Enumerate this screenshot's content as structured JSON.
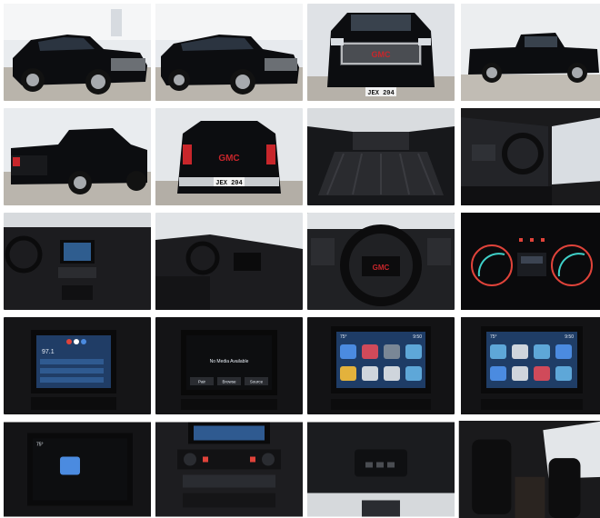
{
  "gallery": {
    "plates": {
      "front": "JEX 204",
      "rear": "JEX 204"
    },
    "brand": {
      "badge": "GMC",
      "color": "#c8262b"
    },
    "screens": {
      "radio_freq": "97.1",
      "no_media": "No Media Available",
      "buttons": [
        "Pair",
        "Browse",
        "Source"
      ],
      "temp": "75°",
      "clock": "9:50"
    },
    "colors": {
      "truck": "#0c0d10",
      "showroom_floor": "#b9b4ab",
      "interior": "#1a1a1c",
      "gauge_red": "#e0433a",
      "gauge_teal": "#3fd0c8"
    }
  }
}
